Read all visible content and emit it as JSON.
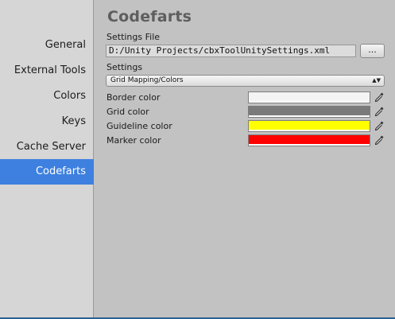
{
  "sidebar": {
    "items": [
      {
        "label": "General",
        "selected": false
      },
      {
        "label": "External Tools",
        "selected": false
      },
      {
        "label": "Colors",
        "selected": false
      },
      {
        "label": "Keys",
        "selected": false
      },
      {
        "label": "Cache Server",
        "selected": false
      },
      {
        "label": "Codefarts",
        "selected": true
      }
    ],
    "selected_color": "#3d80df"
  },
  "main": {
    "title": "Codefarts",
    "settings_file": {
      "label": "Settings File",
      "value": "D:/Unity Projects/cbxToolUnitySettings.xml",
      "browse_label": "..."
    },
    "settings": {
      "label": "Settings",
      "selected_option": "Grid Mapping/Colors",
      "arrow_glyph": "▲▼"
    },
    "colors": [
      {
        "label": "Border color",
        "value": "#f4f4f4",
        "icon": "eyedropper-icon"
      },
      {
        "label": "Grid color",
        "value": "#7a7a7a",
        "icon": "eyedropper-icon"
      },
      {
        "label": "Guideline color",
        "value": "#ffff00",
        "icon": "eyedropper-icon"
      },
      {
        "label": "Marker color",
        "value": "#ff0000",
        "icon": "eyedropper-icon"
      }
    ]
  }
}
